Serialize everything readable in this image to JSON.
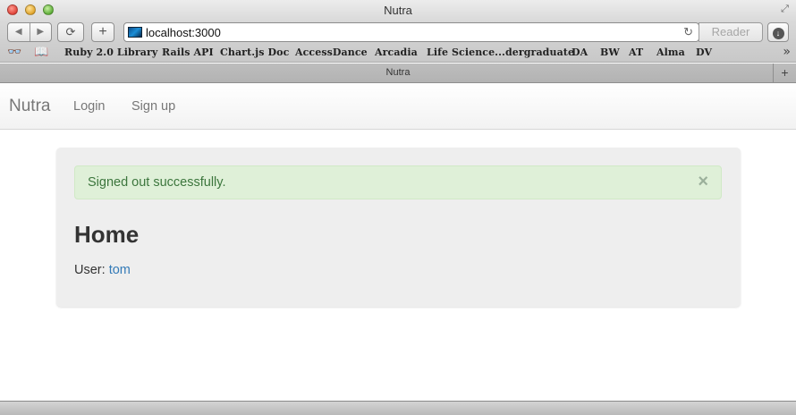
{
  "window": {
    "title": "Nutra"
  },
  "toolbar": {
    "back_icon": "back-arrow-icon",
    "forward_icon": "forward-arrow-icon",
    "share_icon": "share-icon",
    "add_label": "+",
    "url": "localhost:3000",
    "reader_label": "Reader",
    "reload_icon": "reload-icon",
    "download_icon": "download-icon"
  },
  "bookmarks": {
    "items": [
      "Ruby 2.0 Library",
      "Rails API",
      "Chart.js Doc",
      "AccessDance",
      "Arcadia",
      "Life Science...dergraduate",
      "DA",
      "BW",
      "AT",
      "Alma",
      "DV"
    ],
    "more_label": "»"
  },
  "tab": {
    "label": "Nutra",
    "new_tab_label": "+"
  },
  "navbar": {
    "brand": "Nutra",
    "links": [
      "Login",
      "Sign up"
    ]
  },
  "alert": {
    "message": "Signed out successfully.",
    "close_label": "×",
    "colors": {
      "background": "#dff0d8",
      "text": "#3c763d"
    }
  },
  "main": {
    "title": "Home",
    "user_label": "User:",
    "user_name": "tom",
    "link_color": "#337ab7"
  }
}
